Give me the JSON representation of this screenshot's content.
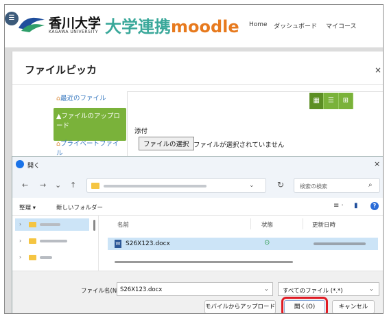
{
  "header": {
    "univ_name": "香川大学",
    "univ_sub": "KAGAWA UNIVERSITY",
    "brand_prefix": "大学連携",
    "brand_moodle": "moodle",
    "nav": [
      "Home",
      "ダッシュボード",
      "マイコース"
    ]
  },
  "picker": {
    "title": "ファイルピッカ",
    "close": "×",
    "sidebar": [
      {
        "label": "最近のファイル"
      },
      {
        "label": "ファイルのアップロード"
      },
      {
        "label": "プライベートファイル"
      }
    ],
    "attach_label": "添付",
    "choose_button": "ファイルの選択",
    "no_file_text": "ファイルが選択されていません"
  },
  "dialog": {
    "title": "開く",
    "close": "×",
    "search_placeholder": "検索の検索",
    "toolbar": {
      "organize": "整理 ▾",
      "new_folder": "新しいフォルダー"
    },
    "columns": [
      "名前",
      "状態",
      "更新日時"
    ],
    "files": [
      {
        "name": "S26X123.docx"
      }
    ],
    "filename_label": "ファイル名(N):",
    "filename_value": "S26X123.docx",
    "file_type": "すべてのファイル (*.*)",
    "upload_mobile_button": "モバイルからアップロード",
    "open_button": "開く(O)",
    "cancel_button": "キャンセル"
  }
}
